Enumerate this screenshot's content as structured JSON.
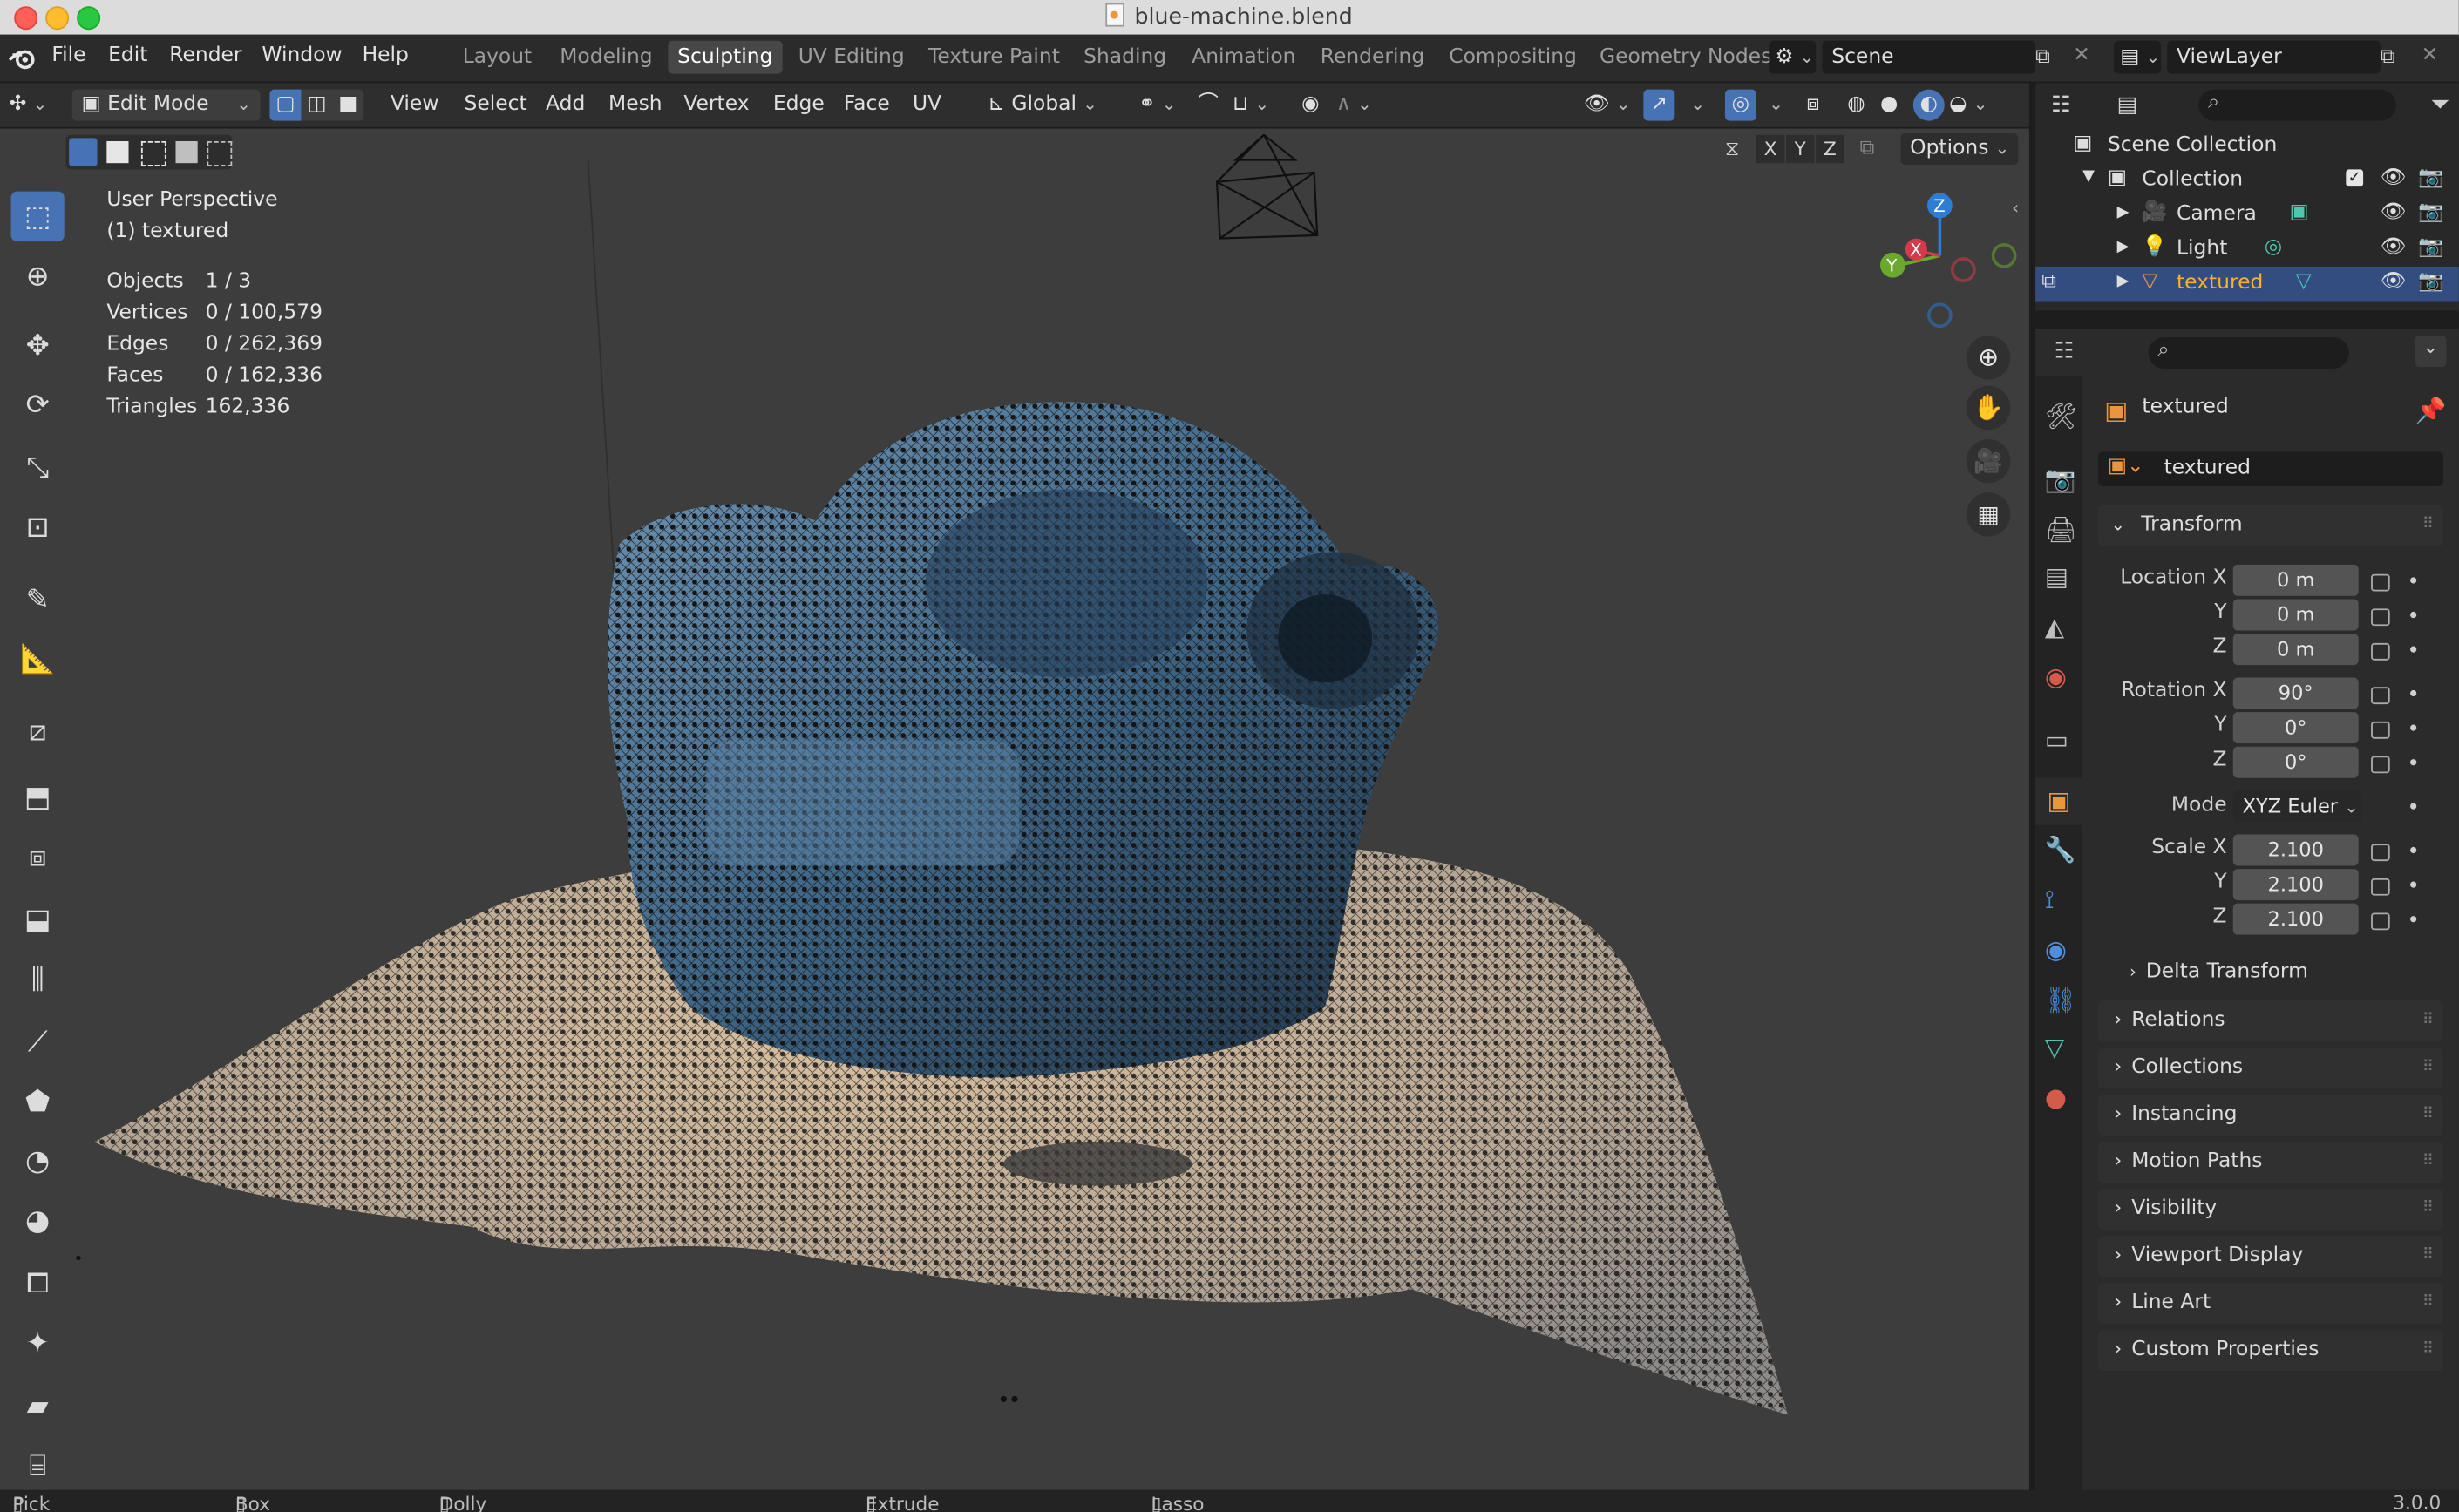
{
  "window": {
    "title": "blue-machine.blend"
  },
  "menu": [
    "File",
    "Edit",
    "Render",
    "Window",
    "Help"
  ],
  "workspaces": [
    "Layout",
    "Modeling",
    "Sculpting",
    "UV Editing",
    "Texture Paint",
    "Shading",
    "Animation",
    "Rendering",
    "Compositing",
    "Geometry Nodes"
  ],
  "active_workspace": "Sculpting",
  "scene": {
    "name": "Scene",
    "view_layer": "ViewLayer"
  },
  "header": {
    "mode": "Edit Mode",
    "menus": [
      "View",
      "Select",
      "Add",
      "Mesh",
      "Vertex",
      "Edge",
      "Face",
      "UV"
    ],
    "orientation": "Global",
    "options": "Options",
    "axes": [
      "X",
      "Y",
      "Z"
    ]
  },
  "overlay": {
    "view_name": "User Perspective",
    "object_label": "(1) textured",
    "stats": [
      {
        "label": "Objects",
        "value": "1 / 3"
      },
      {
        "label": "Vertices",
        "value": "0 / 100,579"
      },
      {
        "label": "Edges",
        "value": "0 / 262,369"
      },
      {
        "label": "Faces",
        "value": "0 / 162,336"
      },
      {
        "label": "Triangles",
        "value": "162,336"
      }
    ]
  },
  "gizmo": {
    "z": "Z",
    "y": "Y",
    "x": "X"
  },
  "outliner": {
    "scene_collection": "Scene Collection",
    "collection": "Collection",
    "items": [
      "Camera",
      "Light",
      "textured"
    ],
    "selected": "textured"
  },
  "properties": {
    "object_name": "textured",
    "datablock_name": "textured",
    "transform_title": "Transform",
    "location": {
      "label": "Location X",
      "x": "0 m",
      "y": "0 m",
      "z": "0 m"
    },
    "rotation": {
      "label": "Rotation X",
      "x": "90°",
      "y": "0°",
      "z": "0°"
    },
    "mode": {
      "label": "Mode",
      "value": "XYZ Euler"
    },
    "scale": {
      "label": "Scale X",
      "x": "2.100",
      "y": "2.100",
      "z": "2.100"
    },
    "axis_y": "Y",
    "axis_z": "Z",
    "delta": "Delta Transform",
    "panels": [
      "Relations",
      "Collections",
      "Instancing",
      "Motion Paths",
      "Visibility",
      "Viewport Display",
      "Line Art",
      "Custom Properties"
    ]
  },
  "status": {
    "items": [
      "Pick Shortest Path",
      "Box Select",
      "Dolly View",
      "Extrude to Cursor or Add",
      "Lasso Select"
    ],
    "version": "3.0.0"
  },
  "colors": {
    "accent": "#4772b3",
    "selection": "#334d80",
    "active_tab": "#474747",
    "mesh_blue": "#3d6a8e",
    "mesh_base": "#c9b39a"
  }
}
